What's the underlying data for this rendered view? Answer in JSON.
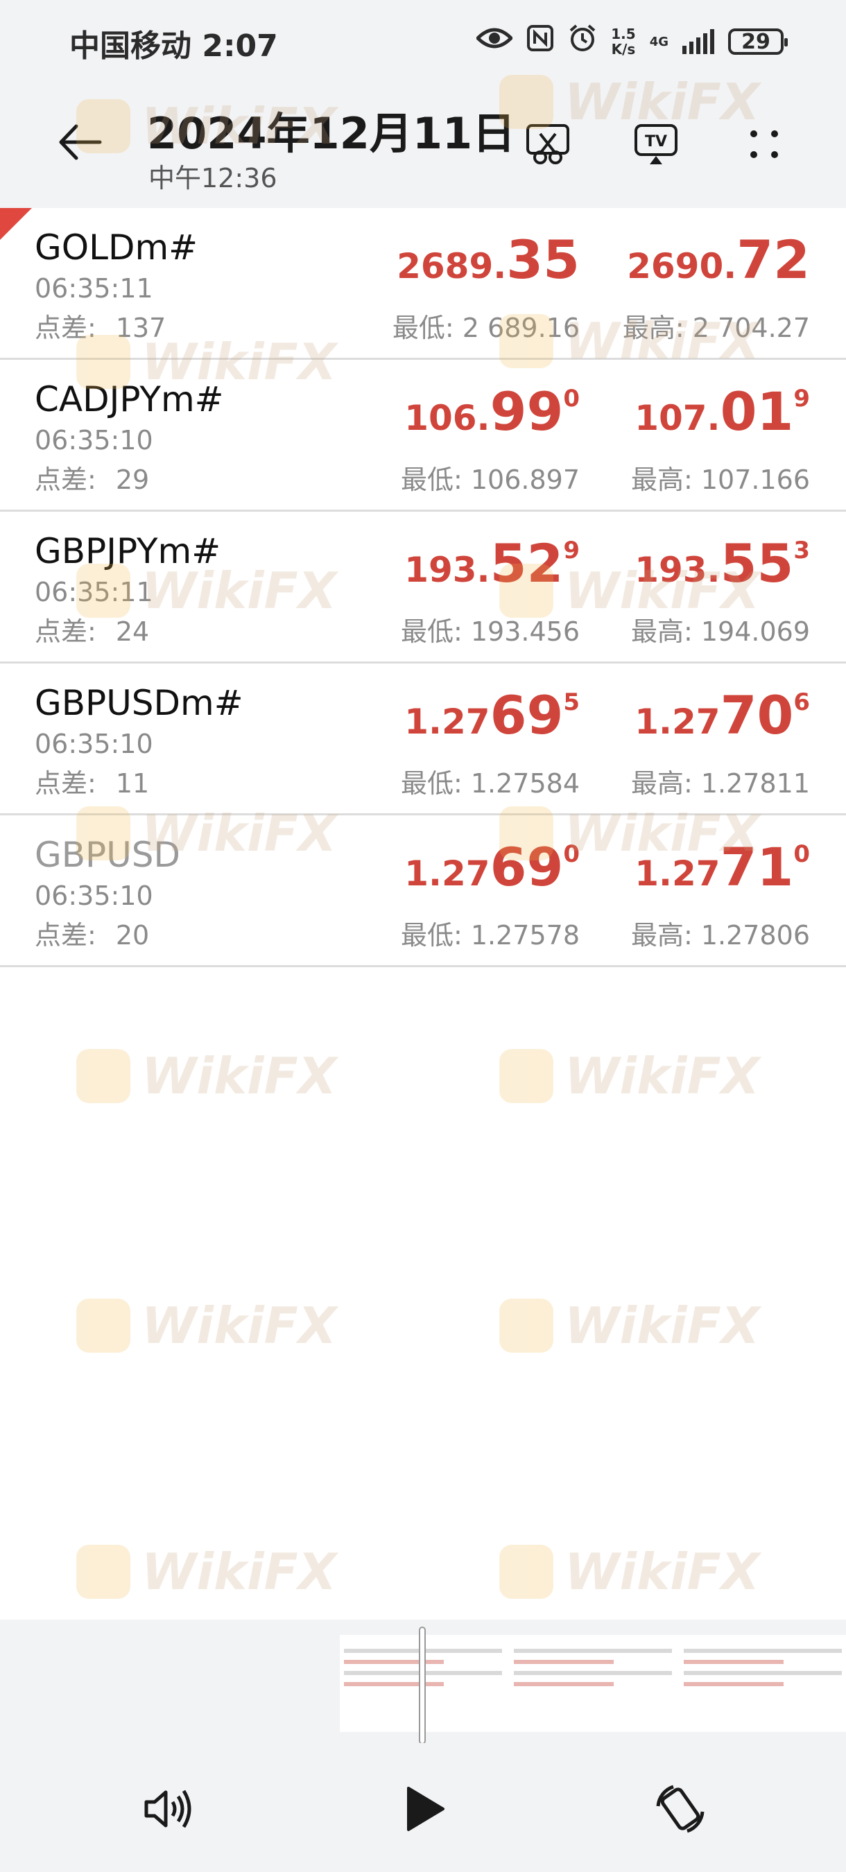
{
  "status_bar": {
    "carrier": "中国移动",
    "time": "2:07",
    "speed_top": "1.5",
    "speed_bottom": "K/s",
    "network": "4G",
    "battery": "29",
    "icons": [
      "eye-icon",
      "nfc-icon",
      "alarm-icon",
      "signal-icon",
      "battery-icon"
    ]
  },
  "viewer_header": {
    "date": "2024年12月11日",
    "time": "中午12:36",
    "icons": [
      "back-arrow-icon",
      "edit-image-icon",
      "cast-tv-icon",
      "more-icon"
    ],
    "tv_label": "TV"
  },
  "labels": {
    "spread": "点差:",
    "low": "最低:",
    "high": "最高:"
  },
  "quotes": [
    {
      "symbol": "GOLDm#",
      "time": "06:35:11",
      "spread": "137",
      "bid": {
        "prefix": "2689.",
        "big": "35",
        "sup": ""
      },
      "ask": {
        "prefix": "2690.",
        "big": "72",
        "sup": ""
      },
      "low": "2 689.16",
      "high": "2 704.27"
    },
    {
      "symbol": "CADJPYm#",
      "time": "06:35:10",
      "spread": "29",
      "bid": {
        "prefix": "106.",
        "big": "99",
        "sup": "0"
      },
      "ask": {
        "prefix": "107.",
        "big": "01",
        "sup": "9"
      },
      "low": "106.897",
      "high": "107.166"
    },
    {
      "symbol": "GBPJPYm#",
      "time": "06:35:11",
      "spread": "24",
      "bid": {
        "prefix": "193.",
        "big": "52",
        "sup": "9"
      },
      "ask": {
        "prefix": "193.",
        "big": "55",
        "sup": "3"
      },
      "low": "193.456",
      "high": "194.069"
    },
    {
      "symbol": "GBPUSDm#",
      "time": "06:35:10",
      "spread": "11",
      "bid": {
        "prefix": "1.27",
        "big": "69",
        "sup": "5"
      },
      "ask": {
        "prefix": "1.27",
        "big": "70",
        "sup": "6"
      },
      "low": "1.27584",
      "high": "1.27811"
    },
    {
      "symbol": "GBPUSD",
      "time": "06:35:10",
      "spread": "20",
      "bid": {
        "prefix": "1.27",
        "big": "69",
        "sup": "0"
      },
      "ask": {
        "prefix": "1.27",
        "big": "71",
        "sup": "0"
      },
      "low": "1.27578",
      "high": "1.27806"
    }
  ],
  "watermark": {
    "text": "WikiFX"
  },
  "controls": {
    "icons": [
      "volume-icon",
      "play-icon",
      "rotate-screen-icon"
    ]
  },
  "colors": {
    "price_red": "#d0453b",
    "corner_red": "#e0473e",
    "bar_bg": "#f2f3f5"
  }
}
